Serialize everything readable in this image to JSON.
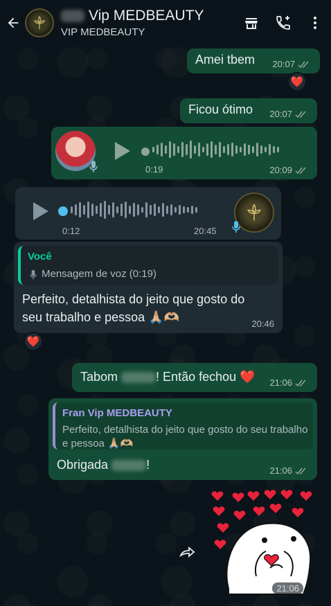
{
  "header": {
    "title": "Vip MEDBEAUTY",
    "subtitle": "VIP MEDBEAUTY"
  },
  "messages": {
    "m1": {
      "text": "Amei tbem",
      "time": "20:07",
      "reaction": "❤️"
    },
    "m2": {
      "text": "Ficou ótimo",
      "time": "20:07"
    },
    "m3": {
      "duration": "0:19",
      "time": "20:09"
    },
    "m4": {
      "duration": "0:12",
      "time": "20:45"
    },
    "m5": {
      "quote_author": "Você",
      "quote_text": "Mensagem de voz (0:19)",
      "text": "Perfeito, detalhista do jeito que gosto do seu trabalho e pessoa 🙏🏼🫶🏼",
      "time": "20:46",
      "reaction": "❤️"
    },
    "m6": {
      "text_before": "Tabom",
      "text_after": "! Então fechou ❤️",
      "time": "21:06"
    },
    "m7": {
      "quote_author": "Fran Vip MEDBEAUTY",
      "quote_text": "Perfeito, detalhista do jeito que gosto do seu trabalho e pessoa 🙏🏼🫶🏼",
      "text_before": "Obrigada",
      "text_after": "!",
      "time": "21:06"
    },
    "m8": {
      "time": "21:06"
    }
  },
  "icons": {
    "back": "arrow-left-icon",
    "store": "store-icon",
    "add_call": "add-call-icon",
    "menu": "more-vertical-icon",
    "forward": "forward-icon",
    "mic": "mic-icon"
  },
  "colors": {
    "background": "#0b141a",
    "outgoing_bubble": "#144d37",
    "incoming_bubble": "#202c33",
    "accent_green": "#06cf9c",
    "reply_purple": "#a79ff0",
    "heart_red": "#e8233b"
  }
}
